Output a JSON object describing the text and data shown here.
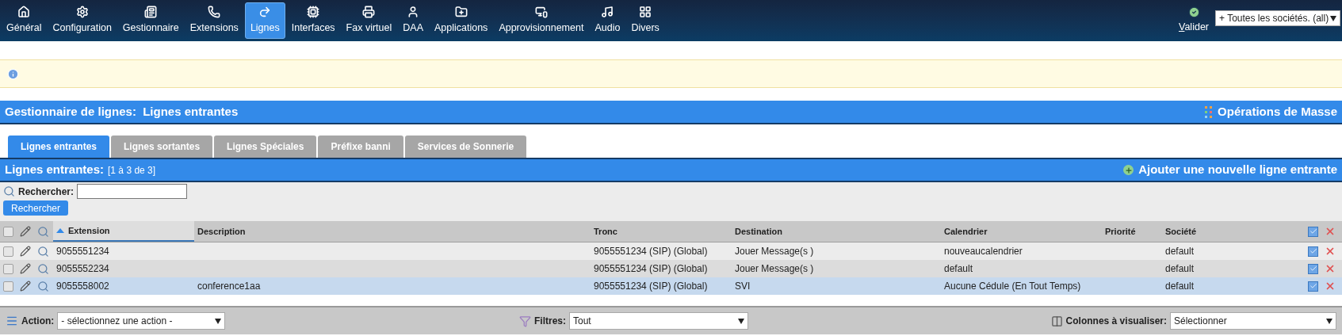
{
  "nav": {
    "items": [
      {
        "label": "Général",
        "selected": false
      },
      {
        "label": "Configuration",
        "selected": false
      },
      {
        "label": "Gestionnaire",
        "selected": false
      },
      {
        "label": "Extensions",
        "selected": false
      },
      {
        "label": "Lignes",
        "selected": true
      },
      {
        "label": "Interfaces",
        "selected": false
      },
      {
        "label": "Fax virtuel",
        "selected": false
      },
      {
        "label": "DAA",
        "selected": false
      },
      {
        "label": "Applications",
        "selected": false
      },
      {
        "label": "Approvisionnement",
        "selected": false
      },
      {
        "label": "Audio",
        "selected": false
      },
      {
        "label": "Divers",
        "selected": false
      }
    ],
    "validate": "Valider",
    "company_select": {
      "value": "+ Toutes les sociétés. (all)"
    }
  },
  "page_header": {
    "title": "Gestionnaire de lignes:  Lignes entrantes",
    "mass_operations": "Opérations de Masse"
  },
  "tabs": [
    {
      "label": "Lignes entrantes",
      "selected": true
    },
    {
      "label": "Lignes sortantes",
      "selected": false
    },
    {
      "label": "Lignes Spéciales",
      "selected": false
    },
    {
      "label": "Préfixe banni",
      "selected": false
    },
    {
      "label": "Services de Sonnerie",
      "selected": false
    }
  ],
  "section": {
    "title": "Lignes entrantes:",
    "count": "[1 à 3 de 3]",
    "add_link": "Ajouter une nouvelle ligne entrante"
  },
  "search": {
    "label": "Rechercher:",
    "button": "Rechercher"
  },
  "table": {
    "select_all_checked": false,
    "columns": [
      {
        "label": "Extension",
        "sorted": true
      },
      {
        "label": "Description",
        "sorted": false
      },
      {
        "label": "Tronc",
        "sorted": false
      },
      {
        "label": "Destination",
        "sorted": false
      },
      {
        "label": "Calendrier",
        "sorted": false
      },
      {
        "label": "Priorité",
        "sorted": false
      },
      {
        "label": "Société",
        "sorted": false
      }
    ],
    "rows": [
      {
        "checked": false,
        "selected": false,
        "cells": [
          "9055551234",
          "",
          "9055551234 (SIP) (Global)",
          "Jouer Message(s )",
          "nouveaucalendrier",
          "",
          "default"
        ]
      },
      {
        "checked": false,
        "selected": false,
        "cells": [
          "9055552234",
          "",
          "9055551234 (SIP) (Global)",
          "Jouer Message(s )",
          "default",
          "",
          "default"
        ]
      },
      {
        "checked": false,
        "selected": true,
        "cells": [
          "9055558002",
          "conference1aa",
          "9055551234 (SIP) (Global)",
          "SVI",
          "Aucune Cédule (En Tout Temps)",
          "",
          "default"
        ]
      }
    ]
  },
  "footer": {
    "action": {
      "label": "Action:",
      "value": "- sélectionnez une action -"
    },
    "filters": {
      "label": "Filtres:",
      "value": "Tout"
    },
    "columns": {
      "label": "Colonnes à visualiser:",
      "value": "Sélectionner"
    }
  }
}
